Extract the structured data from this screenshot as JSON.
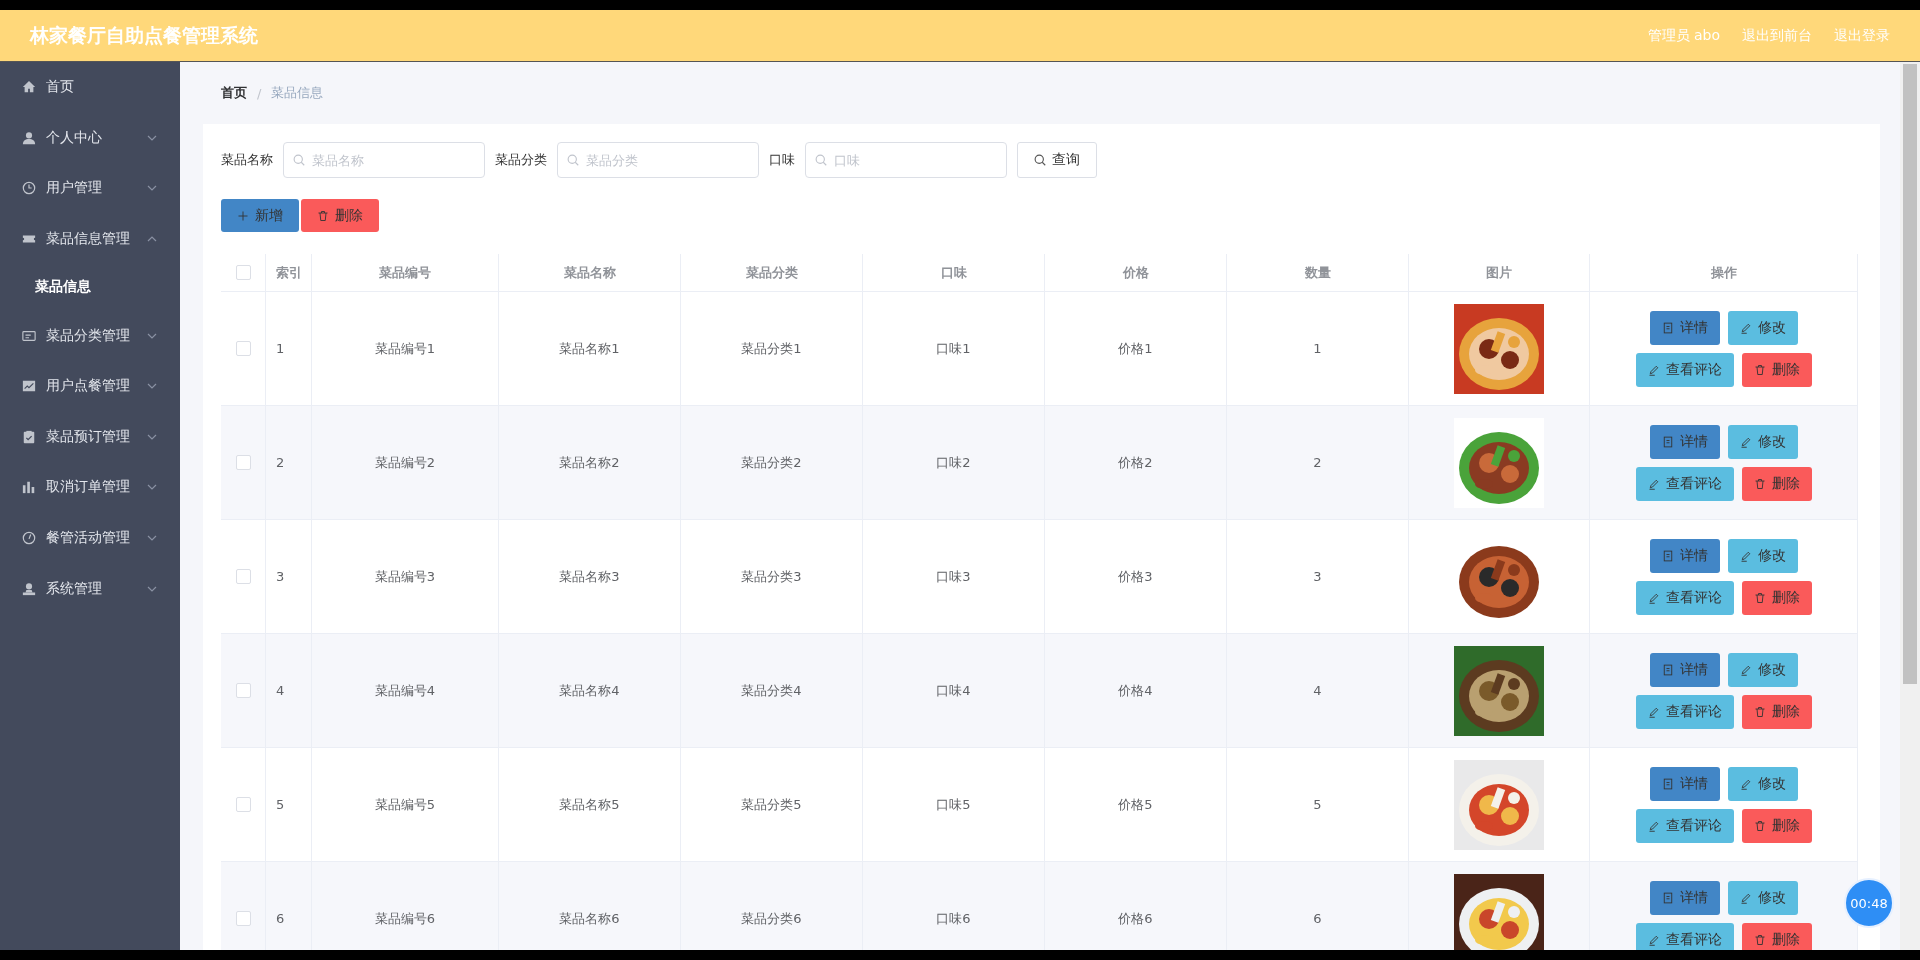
{
  "header": {
    "title": "林家餐厅自助点餐管理系统",
    "links": [
      "管理员 abo",
      "退出到前台",
      "退出登录"
    ]
  },
  "sidebar": {
    "items": [
      {
        "label": "首页",
        "kind": "link"
      },
      {
        "label": "个人中心",
        "kind": "menu",
        "expanded": false
      },
      {
        "label": "用户管理",
        "kind": "menu",
        "expanded": false
      },
      {
        "label": "菜品信息管理",
        "kind": "menu",
        "expanded": true,
        "children": [
          {
            "label": "菜品信息",
            "selected": true
          }
        ]
      },
      {
        "label": "菜品分类管理",
        "kind": "menu",
        "expanded": false
      },
      {
        "label": "用户点餐管理",
        "kind": "menu",
        "expanded": false
      },
      {
        "label": "菜品预订管理",
        "kind": "menu",
        "expanded": false
      },
      {
        "label": "取消订单管理",
        "kind": "menu",
        "expanded": false
      },
      {
        "label": "餐管活动管理",
        "kind": "menu",
        "expanded": false
      },
      {
        "label": "系统管理",
        "kind": "menu",
        "expanded": false
      }
    ]
  },
  "breadcrumb": [
    "首页",
    "菜品信息"
  ],
  "breadcrumb_separator": "/",
  "search": {
    "fields": [
      {
        "label": "菜品名称",
        "placeholder": "菜品名称"
      },
      {
        "label": "菜品分类",
        "placeholder": "菜品分类"
      },
      {
        "label": "口味",
        "placeholder": "口味"
      }
    ],
    "button": "查询"
  },
  "toolbar": [
    {
      "label": "新增",
      "kind": "add"
    },
    {
      "label": "删除",
      "kind": "delete"
    }
  ],
  "table": {
    "header_checked": false,
    "columns": [
      "索引",
      "菜品编号",
      "菜品名称",
      "菜品分类",
      "口味",
      "价格",
      "数量",
      "图片",
      "操作"
    ],
    "rows": [
      {
        "checked": false,
        "cells": [
          "1",
          "菜品编号1",
          "菜品名称1",
          "菜品分类1",
          "口味1",
          "价格1",
          "1"
        ],
        "actions": [
          {
            "label": "详情",
            "kind": "detail"
          },
          {
            "label": "修改",
            "kind": "edit"
          },
          {
            "label": "查看评论",
            "kind": "comment"
          },
          {
            "label": "删除",
            "kind": "delete"
          }
        ]
      },
      {
        "checked": false,
        "cells": [
          "2",
          "菜品编号2",
          "菜品名称2",
          "菜品分类2",
          "口味2",
          "价格2",
          "2"
        ],
        "actions": [
          {
            "label": "详情",
            "kind": "detail"
          },
          {
            "label": "修改",
            "kind": "edit"
          },
          {
            "label": "查看评论",
            "kind": "comment"
          },
          {
            "label": "删除",
            "kind": "delete"
          }
        ]
      },
      {
        "checked": false,
        "cells": [
          "3",
          "菜品编号3",
          "菜品名称3",
          "菜品分类3",
          "口味3",
          "价格3",
          "3"
        ],
        "actions": [
          {
            "label": "详情",
            "kind": "detail"
          },
          {
            "label": "修改",
            "kind": "edit"
          },
          {
            "label": "查看评论",
            "kind": "comment"
          },
          {
            "label": "删除",
            "kind": "delete"
          }
        ]
      },
      {
        "checked": false,
        "cells": [
          "4",
          "菜品编号4",
          "菜品名称4",
          "菜品分类4",
          "口味4",
          "价格4",
          "4"
        ],
        "actions": [
          {
            "label": "详情",
            "kind": "detail"
          },
          {
            "label": "修改",
            "kind": "edit"
          },
          {
            "label": "查看评论",
            "kind": "comment"
          },
          {
            "label": "删除",
            "kind": "delete"
          }
        ]
      },
      {
        "checked": false,
        "cells": [
          "5",
          "菜品编号5",
          "菜品名称5",
          "菜品分类5",
          "口味5",
          "价格5",
          "5"
        ],
        "actions": [
          {
            "label": "详情",
            "kind": "detail"
          },
          {
            "label": "修改",
            "kind": "edit"
          },
          {
            "label": "查看评论",
            "kind": "comment"
          },
          {
            "label": "删除",
            "kind": "delete"
          }
        ]
      },
      {
        "checked": false,
        "cells": [
          "6",
          "菜品编号6",
          "菜品名称6",
          "菜品分类6",
          "口味6",
          "价格6",
          "6"
        ],
        "actions": [
          {
            "label": "详情",
            "kind": "detail"
          },
          {
            "label": "修改",
            "kind": "edit"
          },
          {
            "label": "查看评论",
            "kind": "comment"
          },
          {
            "label": "删除",
            "kind": "delete"
          }
        ]
      }
    ]
  },
  "recording_timer": "00:48"
}
